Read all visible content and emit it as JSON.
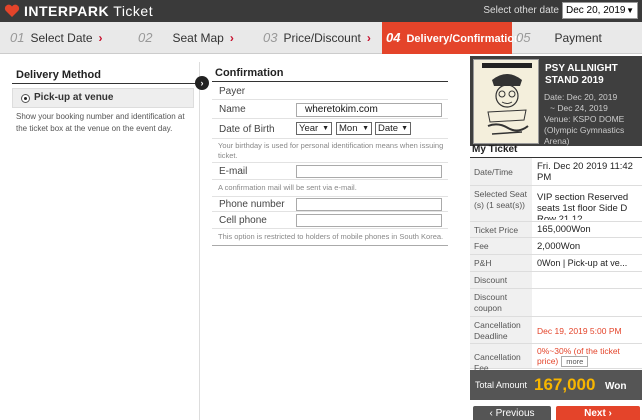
{
  "header": {
    "brand_bold": "INTERPARK",
    "brand_light": "Ticket",
    "select_other_date_label": "Select other date",
    "date_value": "Dec 20, 2019"
  },
  "steps": [
    {
      "num": "01",
      "label": "Select Date"
    },
    {
      "num": "02",
      "label": "Seat Map"
    },
    {
      "num": "03",
      "label": "Price/Discount"
    },
    {
      "num": "04",
      "label": "Delivery/Confirmation"
    },
    {
      "num": "05",
      "label": "Payment"
    }
  ],
  "delivery": {
    "title": "Delivery Method",
    "option_label": "Pick-up at venue",
    "description": "Show your booking number and identification at the ticket box at the venue on the event day."
  },
  "confirmation": {
    "title": "Confirmation",
    "payer_label": "Payer",
    "name_label": "Name",
    "name_value": "wheretokim.com",
    "dob_label": "Date of Birth",
    "year_option": "Year",
    "month_option": "Mon",
    "date_option": "Date",
    "birthday_note": "Your birthday is used for personal identification means when issuing ticket.",
    "email_label": "E-mail",
    "email_value": "",
    "email_note": "A confirmation mail will be sent via e-mail.",
    "phone_label": "Phone number",
    "cell_label": "Cell phone",
    "phone_note": "This option is restricted to holders of mobile phones in South Korea."
  },
  "event": {
    "title": "PSY ALLNIGHT STAND 2019",
    "date_line1": "Date: Dec 20, 2019",
    "date_line2": "~ Dec 24, 2019",
    "venue": "Venue: KSPO DOME (Olympic Gymnastics Arena)"
  },
  "my_ticket": {
    "title": "My Ticket",
    "rows": {
      "date_time": {
        "label": "Date/Time",
        "value": "Fri. Dec 20 2019 11:42 PM"
      },
      "selected_seat": {
        "label": "Selected Seat (s) (1 seat(s))",
        "value": "VIP section Reserved seats 1st floor Side D Row 21 1? "
      },
      "ticket_price": {
        "label": "Ticket Price",
        "value": "165,000Won"
      },
      "fee": {
        "label": "Fee",
        "value": "2,000Won"
      },
      "ph": {
        "label": "P&H",
        "value": "0Won | Pick-up at ve..."
      },
      "discount": {
        "label": "Discount",
        "value": ""
      },
      "discount_coupon": {
        "label": "Discount coupon",
        "value": ""
      },
      "cancel_deadline": {
        "label": "Cancellation Deadline",
        "value": "Dec 19, 2019 5:00 PM"
      },
      "cancel_fee": {
        "label": "Cancellation Fee",
        "value": "0%~30% (of the ticket price)",
        "more": "more"
      }
    },
    "total_label": "Total Amount",
    "total_amount": "167,000",
    "total_currency": "Won"
  },
  "buttons": {
    "previous": "Previous",
    "next": "Next"
  },
  "colors": {
    "accent": "#e4442a",
    "header_bg": "#3a3a3a",
    "total_amount": "#f7b500"
  }
}
